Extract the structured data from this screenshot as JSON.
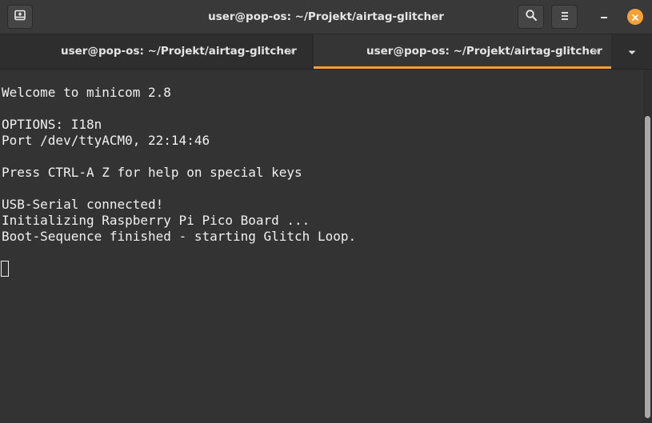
{
  "window": {
    "title": "user@pop-os: ~/Projekt/airtag-glitcher",
    "accent_color": "#f6a035",
    "icons": {
      "new_tab": "new-tab-icon",
      "search": "search-icon",
      "menu": "hamburger-menu-icon",
      "minimize": "minimize-icon",
      "close": "close-icon"
    }
  },
  "tabs": [
    {
      "label": "user@pop-os: ~/Projekt/airtag-glitcher",
      "active": false
    },
    {
      "label": "user@pop-os: ~/Projekt/airtag-glitcher",
      "active": true
    }
  ],
  "terminal": {
    "lines": [
      "Welcome to minicom 2.8",
      "",
      "OPTIONS: I18n",
      "Port /dev/ttyACM0, 22:14:46",
      "",
      "Press CTRL-A Z for help on special keys",
      "",
      "USB-Serial connected!",
      "Initializing Raspberry Pi Pico Board ...",
      "Boot-Sequence finished - starting Glitch Loop."
    ]
  }
}
